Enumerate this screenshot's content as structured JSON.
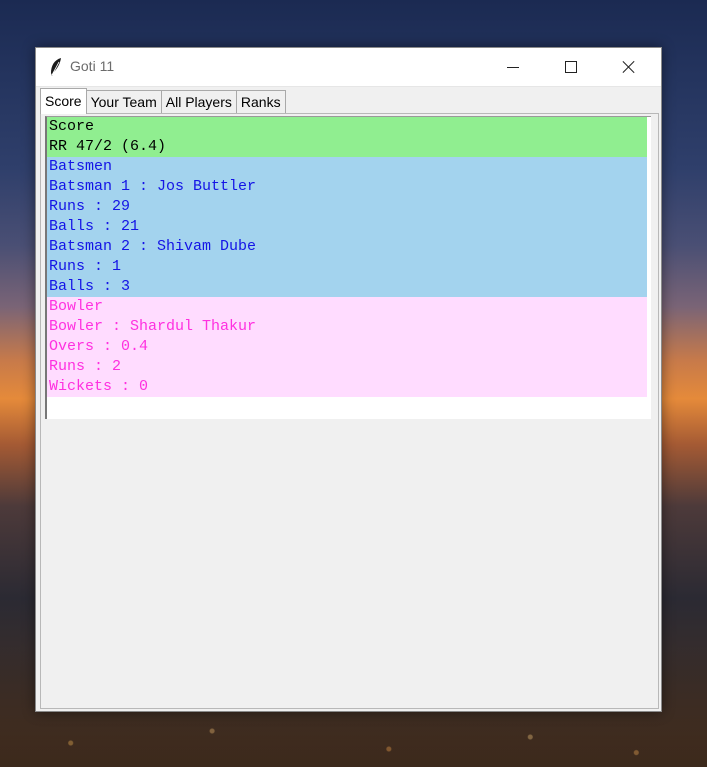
{
  "window": {
    "title": "Goti 11"
  },
  "tabs": [
    {
      "label": "Score",
      "active": true
    },
    {
      "label": "Your Team",
      "active": false
    },
    {
      "label": "All Players",
      "active": false
    },
    {
      "label": "Ranks",
      "active": false
    }
  ],
  "score_section": {
    "header": "Score",
    "rr_line": "RR 47/2 (6.4)"
  },
  "batsmen_section": {
    "header": "Batsmen",
    "batsman1": "Batsman 1 : Jos Buttler",
    "batsman1_runs": "Runs : 29",
    "batsman1_balls": "Balls : 21",
    "batsman2": "Batsman 2 : Shivam Dube",
    "batsman2_runs": "Runs : 1",
    "batsman2_balls": "Balls : 3"
  },
  "bowler_section": {
    "header": "Bowler",
    "bowler": "Bowler : Shardul Thakur",
    "overs": "Overs : 0.4",
    "runs": "Runs : 2",
    "wickets": "Wickets : 0"
  },
  "colors": {
    "score_bg": "#90ee90",
    "batsmen_bg": "#a3d3ee",
    "batsmen_fg": "#1414e6",
    "bowler_bg": "#ffdcff",
    "bowler_fg": "#ff30e0"
  },
  "icons": {
    "app": "feather-icon",
    "minimize": "minimize-icon",
    "maximize": "maximize-icon",
    "close": "close-icon"
  }
}
